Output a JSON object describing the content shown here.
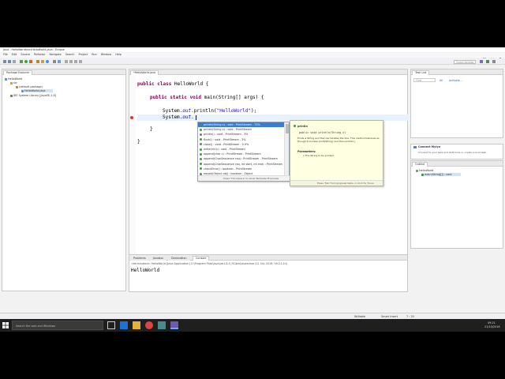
{
  "window": {
    "title": "Java - HelloWorld/src/HelloWorld.java - Eclipse",
    "controls": [
      "—",
      "☐",
      "✕"
    ]
  },
  "menubar": [
    "File",
    "Edit",
    "Source",
    "Refactor",
    "Navigate",
    "Search",
    "Project",
    "Run",
    "Window",
    "Help"
  ],
  "toolbar": {
    "quick_access_placeholder": "Quick Access"
  },
  "package_explorer": {
    "tab_label": "Package Explorer",
    "tree": [
      {
        "label": "HelloWorld",
        "level": 0
      },
      {
        "label": "src",
        "level": 1
      },
      {
        "label": "(default package)",
        "level": 2
      },
      {
        "label": "HelloWorld.java",
        "level": 3,
        "selected": true
      },
      {
        "label": "JRE System Library [JavaSE-1.8]",
        "level": 1
      }
    ]
  },
  "editor": {
    "tab_label": "*HelloWorld.java",
    "lines": {
      "l1_kw": "public class",
      "l1_rest": " HelloWorld {",
      "l2_kw": "public static void",
      "l2_rest": " main(String[] args) {",
      "l3_pre": "System.",
      "l3_fld": "out",
      "l3_mid": ".println(",
      "l3_str": "\"HelloWorld\"",
      "l3_end": ");",
      "l4_pre": "System.",
      "l4_fld": "out",
      "l4_end": ".",
      "l5": "}",
      "l6": "}"
    }
  },
  "content_assist": {
    "items": [
      "println(String x) : void - PrintStream - 72%",
      "println(String x) : void - PrintStream",
      "println() : void - PrintStream - 3%",
      "flush() : void - PrintStream - 3%",
      "close() : void - PrintStream - 0.9%",
      "write(int b) : void - PrintStream",
      "append(char c) : PrintStream - PrintStream",
      "append(CharSequence csq) : PrintStream - PrintStream",
      "append(CharSequence csq, int start, int end) : PrintStream",
      "checkError() : boolean - PrintStream",
      "equals(Object obj) : boolean - Object"
    ],
    "footer": "Press 'Ctrl+Space' to show Template Proposals"
  },
  "javadoc": {
    "title": "println",
    "signature": "public void println(String x)",
    "description": "Prints a String and then terminates the line. This method behaves as though it invokes print(String) and then println().",
    "params_header": "Parameters:",
    "param": "x The String to be printed.",
    "footer": "Press 'Tab' from proposal table or click for focus"
  },
  "task_list": {
    "tab_label": "Task List",
    "find_placeholder": "Find",
    "filter_all": "All",
    "filter_activate": "Activate..."
  },
  "mylyn": {
    "header": "Connect Mylyn",
    "text": "Connect to your task and ALM tools or create a local task."
  },
  "outline": {
    "tab_label": "Outline",
    "items": [
      "HelloWorld",
      "main(String[]) : void"
    ]
  },
  "console": {
    "tabs": [
      "Problems",
      "Javadoc",
      "Declaration",
      "Console"
    ],
    "active_tab": "Console",
    "info": "<terminated> HelloWorld [Java Application] C:\\Program Files\\Java\\jre1.8.0_91\\bin\\javaw.exe (21 Oct 2016, 09:21:10)",
    "output": "HelloWorld"
  },
  "statusbar": {
    "mode": "Writable",
    "insert": "Smart Insert",
    "position": "7 : 20"
  },
  "taskbar": {
    "search_placeholder": "Search the web and Windows",
    "time": "09:21",
    "date": "21/10/2016"
  },
  "colors": {
    "keyword": "#7f0055",
    "string": "#2a00ff",
    "field": "#0000c0",
    "selection": "#3a7bd5",
    "javadoc_bg": "#ffffe1"
  }
}
